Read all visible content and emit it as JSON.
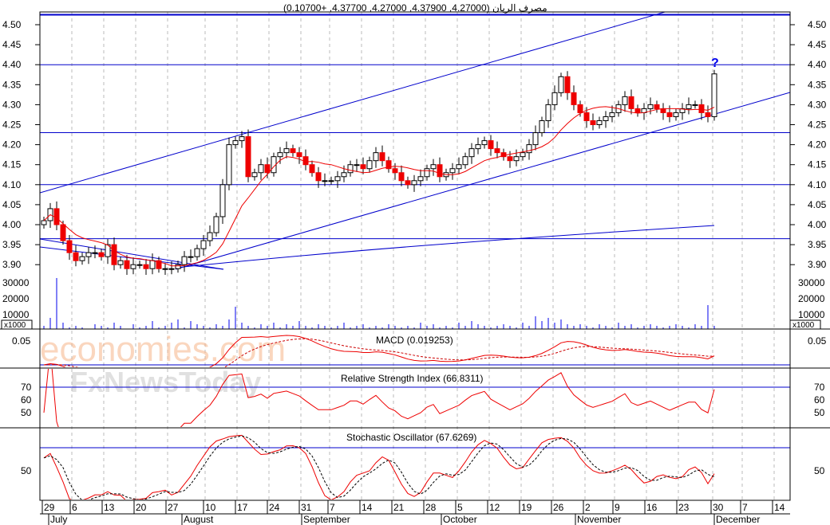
{
  "chart_data": {
    "type": "candlestick",
    "title": "مصرف الريان (4.27000, 4.37900, 4.27000, 4.37700, +0.10700)",
    "price_axis": {
      "ylim": [
        3.87,
        4.55
      ],
      "ticks": [
        "3.90",
        "3.95",
        "4.00",
        "4.05",
        "4.10",
        "4.15",
        "4.20",
        "4.25",
        "4.30",
        "4.35",
        "4.40",
        "4.45",
        "4.50"
      ]
    },
    "volume_axis": {
      "ticks": [
        "10000",
        "20000",
        "30000"
      ],
      "unit_label": "x1000"
    },
    "horizontal_levels": [
      4.525,
      4.4,
      4.23,
      4.1,
      3.965
    ],
    "closes": [
      4.01,
      4.04,
      4.0,
      3.96,
      3.93,
      3.91,
      3.92,
      3.93,
      3.93,
      3.92,
      3.95,
      3.9,
      3.91,
      3.89,
      3.9,
      3.9,
      3.89,
      3.91,
      3.89,
      3.89,
      3.89,
      3.9,
      3.92,
      3.92,
      3.94,
      3.96,
      3.98,
      4.02,
      4.1,
      4.2,
      4.21,
      4.22,
      4.12,
      4.13,
      4.15,
      4.13,
      4.17,
      4.18,
      4.19,
      4.18,
      4.17,
      4.15,
      4.13,
      4.11,
      4.11,
      4.11,
      4.12,
      4.13,
      4.15,
      4.15,
      4.14,
      4.16,
      4.18,
      4.16,
      4.14,
      4.13,
      4.11,
      4.1,
      4.11,
      4.12,
      4.14,
      4.15,
      4.12,
      4.13,
      4.14,
      4.15,
      4.17,
      4.19,
      4.2,
      4.21,
      4.19,
      4.18,
      4.17,
      4.16,
      4.17,
      4.18,
      4.2,
      4.23,
      4.26,
      4.3,
      4.33,
      4.37,
      4.33,
      4.3,
      4.28,
      4.26,
      4.25,
      4.26,
      4.27,
      4.28,
      4.3,
      4.32,
      4.29,
      4.28,
      4.29,
      4.3,
      4.29,
      4.28,
      4.27,
      4.28,
      4.29,
      4.3,
      4.3,
      4.28,
      4.27,
      4.377
    ],
    "volumes": [
      3000,
      8000,
      33000,
      5000,
      2000,
      3000,
      2000,
      1000,
      4000,
      3000,
      2000,
      5000,
      3000,
      1000,
      4000,
      2000,
      3000,
      6000,
      2000,
      3000,
      5000,
      7000,
      2000,
      6000,
      4000,
      3000,
      2000,
      4000,
      3000,
      7000,
      15000,
      5000,
      3000,
      2000,
      4000,
      3000,
      5000,
      2000,
      4000,
      3000,
      6000,
      3000,
      2000,
      4000,
      3000,
      2000,
      3000,
      5000,
      2000,
      3000,
      4000,
      2000,
      3000,
      2000,
      4000,
      3000,
      2000,
      3000,
      2000,
      5000,
      3000,
      4000,
      2000,
      3000,
      2000,
      5000,
      3000,
      6000,
      4000,
      3000,
      2000,
      3000,
      4000,
      3000,
      2000,
      5000,
      3000,
      9000,
      6000,
      8000,
      5000,
      7000,
      4000,
      3000,
      4000,
      3000,
      2000,
      4000,
      3000,
      2000,
      5000,
      3000,
      4000,
      2000,
      3000,
      4000,
      3000,
      2000,
      3000,
      4000,
      3000,
      2000,
      4000,
      3000,
      16000,
      3000
    ],
    "ma_label": "",
    "macd": {
      "label": "MACD (0.019253)",
      "tick": "0.05"
    },
    "rsi": {
      "label": "Relative Strength Index (66.8311)",
      "ticks": [
        "50",
        "60",
        "70"
      ]
    },
    "stochastic": {
      "label": "Stochastic Oscillator (67.6269)",
      "ticks": [
        "50"
      ]
    },
    "x_day_labels": [
      "29",
      "6",
      "13",
      "20",
      "27",
      "10",
      "17",
      "24",
      "31",
      "7",
      "14",
      "21",
      "28",
      "5",
      "12",
      "19",
      "26",
      "2",
      "9",
      "16",
      "23",
      "30",
      "7",
      "14"
    ],
    "x_month_labels": [
      "July",
      "August",
      "September",
      "October",
      "November",
      "December"
    ],
    "marker": "?",
    "watermarks": [
      "economies.com",
      "FxNewsToday"
    ]
  }
}
